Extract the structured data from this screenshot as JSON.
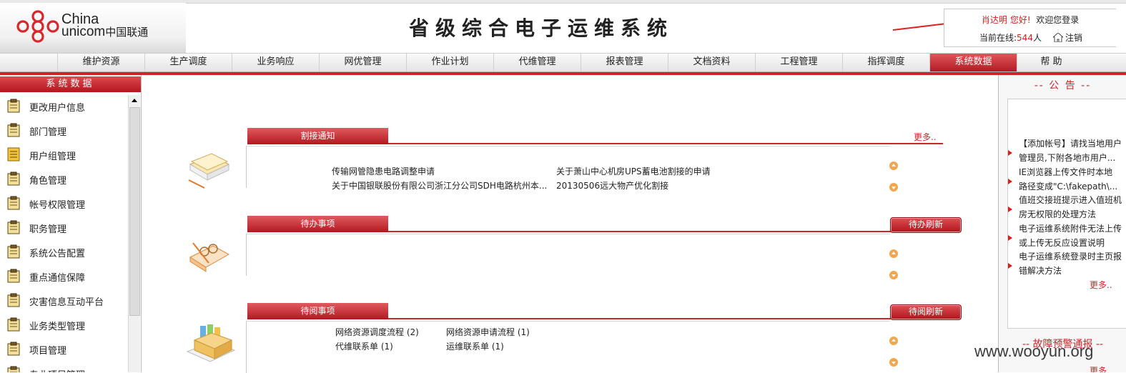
{
  "header": {
    "logo_line1": "China",
    "logo_line2": "unicom",
    "logo_cn": "中国联通",
    "system_title": "省级综合电子运维系统",
    "user_name": "肖达明",
    "greeting": " 您好!",
    "welcome": "欢迎您登录",
    "online_label": "当前在线:",
    "online_count": "544",
    "online_unit": "人",
    "logout": "注销"
  },
  "nav": {
    "items": [
      "维护资源",
      "生产调度",
      "业务响应",
      "网优管理",
      "作业计划",
      "代维管理",
      "报表管理",
      "文档资料",
      "工程管理",
      "指挥调度",
      "系统数据",
      "帮 助"
    ],
    "active": "系统数据"
  },
  "sidebar": {
    "title": "系统数据",
    "items": [
      {
        "label": "更改用户信息",
        "icon": "clipboard-icon"
      },
      {
        "label": "部门管理",
        "icon": "clipboard-icon"
      },
      {
        "label": "用户组管理",
        "icon": "notepad-icon"
      },
      {
        "label": "角色管理",
        "icon": "clipboard-icon"
      },
      {
        "label": "帐号权限管理",
        "icon": "clipboard-icon"
      },
      {
        "label": "职务管理",
        "icon": "clipboard-icon"
      },
      {
        "label": "系统公告配置",
        "icon": "clipboard-icon"
      },
      {
        "label": "重点通信保障",
        "icon": "clipboard-icon"
      },
      {
        "label": "灾害信息互动平台",
        "icon": "clipboard-icon"
      },
      {
        "label": "业务类型管理",
        "icon": "clipboard-icon"
      },
      {
        "label": "项目管理",
        "icon": "clipboard-icon"
      },
      {
        "label": "专业项目管理",
        "icon": "clipboard-icon"
      }
    ]
  },
  "sections": {
    "cutover": {
      "title": "割接通知",
      "more": "更多..",
      "entries": [
        "传输网管隐患电路调整申请",
        "关于萧山中心机房UPS蓄电池割接的申请",
        "关于中国银联股份有限公司浙江分公司SDH电路杭州本...",
        "20130506远大物产优化割接"
      ]
    },
    "todo": {
      "title": "待办事项",
      "refresh": "待办刷新"
    },
    "toread": {
      "title": "待阅事项",
      "refresh": "待阅刷新",
      "entries": [
        "网络资源调度流程 (2)",
        "网络资源申请流程 (1)",
        "代维联系单 (1)",
        "运维联系单 (1)"
      ]
    }
  },
  "notices": {
    "title": "-- 公 告 --",
    "items": [
      [
        "【添加帐号】请找当地用户",
        "管理员,下附各地市用户..."
      ],
      [
        "IE浏览器上传文件时本地",
        "路径变成\"C:\\fakepath\\..."
      ],
      [
        "值班交接班提示进入值班机",
        "房无权限的处理方法"
      ],
      [
        "电子运维系统附件无法上传",
        "或上传无反应设置说明"
      ],
      [
        "电子运维系统登录时主页报",
        "错解决方法"
      ]
    ],
    "more": "更多..",
    "fault_title": "-- 故障预警通报 --",
    "fault_more": "更多.."
  },
  "watermark": "www.wooyun.org"
}
